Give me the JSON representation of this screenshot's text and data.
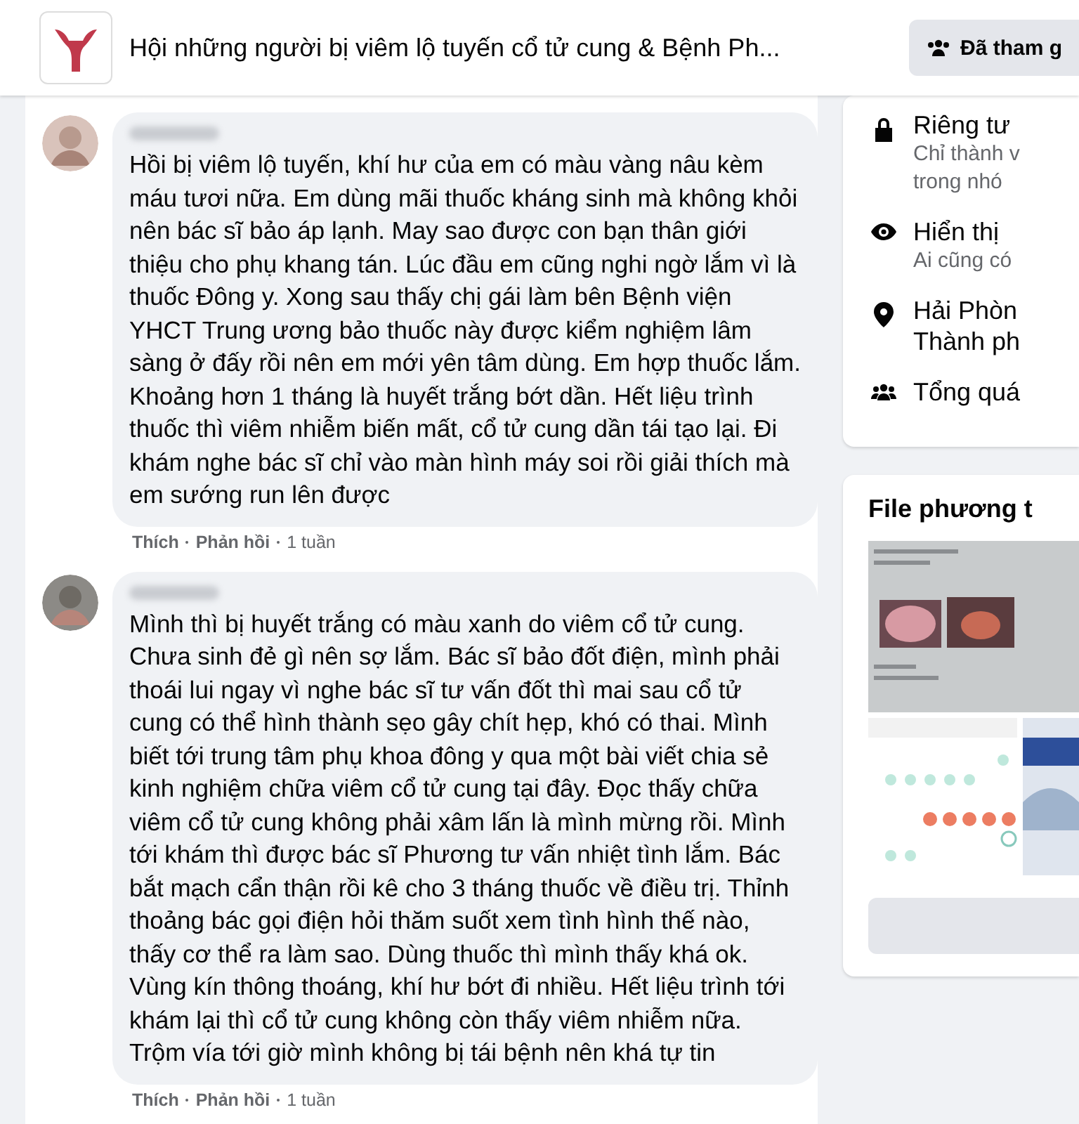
{
  "header": {
    "group_title": "Hội những người bị viêm lộ tuyến cổ tử cung & Bệnh Ph...",
    "join_button": "Đã tham g"
  },
  "comments": [
    {
      "text": "Hồi bị viêm lộ tuyến, khí hư của em có màu vàng nâu kèm máu tươi nữa. Em dùng mãi thuốc kháng sinh mà không khỏi nên bác sĩ bảo áp lạnh. May sao được con bạn thân giới thiệu cho phụ khang tán. Lúc đầu em cũng nghi ngờ lắm vì là thuốc Đông y. Xong sau thấy chị gái làm bên Bệnh viện YHCT Trung ương bảo thuốc này được kiểm nghiệm lâm sàng ở đấy rồi nên em mới yên tâm dùng. Em hợp thuốc lắm. Khoảng hơn 1 tháng là huyết trắng bớt dần. Hết liệu trình thuốc thì viêm nhiễm biến mất, cổ tử cung dần tái tạo lại. Đi khám nghe bác sĩ chỉ vào màn hình máy soi rồi giải thích mà em sướng run lên được",
      "like": "Thích",
      "reply": "Phản hồi",
      "time": "1 tuần"
    },
    {
      "text": "Mình thì bị huyết trắng có màu xanh do viêm cổ tử cung. Chưa sinh đẻ gì nên sợ lắm. Bác sĩ bảo đốt điện, mình phải thoái lui ngay vì nghe bác sĩ tư vấn đốt thì mai sau cổ tử cung có thể hình thành sẹo gây chít hẹp, khó có thai. Mình biết tới trung tâm phụ khoa đông y qua một bài viết chia sẻ kinh nghiệm chữa viêm cổ tử cung tại đây. Đọc thấy chữa viêm cổ tử cung không phải xâm lấn là mình mừng rồi. Mình tới khám thì được bác sĩ Phương tư vấn nhiệt tình lắm. Bác bắt mạch cẩn thận rồi kê cho 3 tháng thuốc về điều trị. Thỉnh thoảng bác gọi điện hỏi thăm suốt xem tình hình thế nào, thấy cơ thể ra làm sao. Dùng thuốc thì mình thấy khá ok. Vùng kín thông thoáng, khí hư bớt đi nhiều. Hết liệu trình tới khám lại thì cổ tử cung không còn thấy viêm nhiễm nữa. Trộm vía tới giờ mình không bị tái bệnh nên khá tự tin",
      "like": "Thích",
      "reply": "Phản hồi",
      "time": "1 tuần"
    }
  ],
  "about": [
    {
      "kind": "lock",
      "title": "Riêng tư",
      "lines": [
        "Chỉ thành v",
        "trong nhó"
      ]
    },
    {
      "kind": "eye",
      "title": "Hiển thị",
      "lines": [
        "Ai cũng có"
      ]
    },
    {
      "kind": "pin",
      "title": "Hải Phòn",
      "title2": "Thành ph"
    },
    {
      "kind": "people",
      "title": "Tổng quá"
    }
  ],
  "media": {
    "title": "File phương t"
  }
}
